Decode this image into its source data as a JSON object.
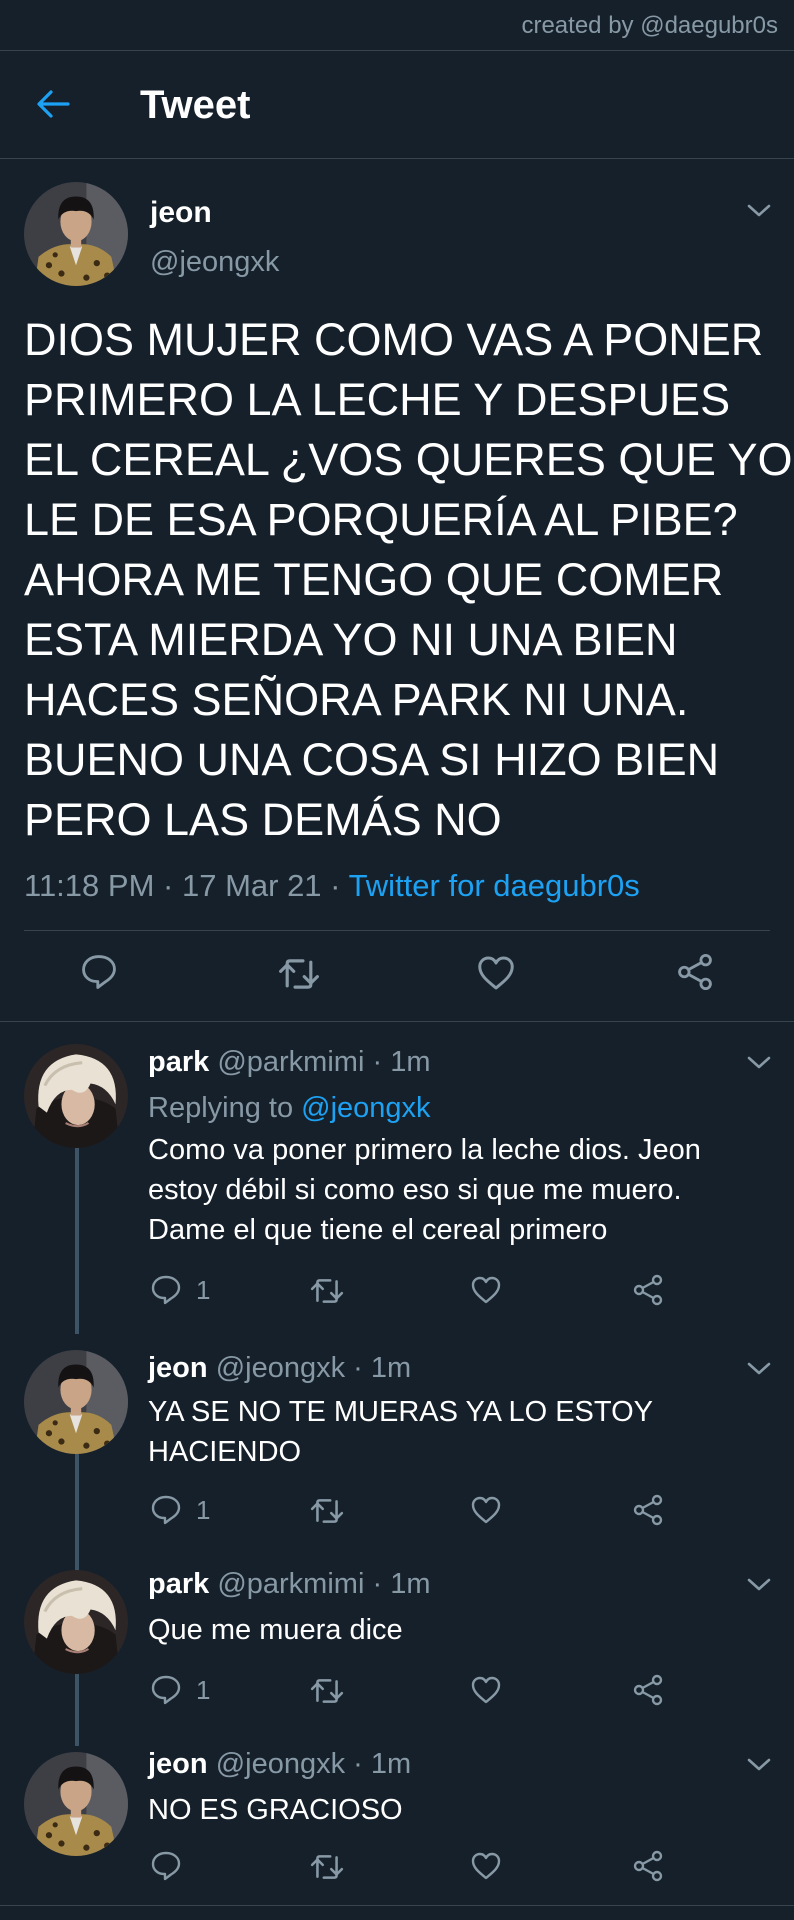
{
  "watermark": "created by @daegubr0s",
  "header": {
    "title": "Tweet",
    "back_icon": "arrow-left-icon"
  },
  "main_tweet": {
    "name": "jeon",
    "handle": "@jeongxk",
    "text_lines": [
      "DIOS MUJER COMO VAS A PONER",
      "PRIMERO LA LECHE Y DESPUES",
      "EL CEREAL ¿VOS QUERES QUE YO",
      "LE DE ESA PORQUERÍA AL PIBE?",
      "AHORA ME TENGO QUE COMER",
      "ESTA MIERDA YO NI UNA BIEN",
      "HACES SEÑORA PARK NI UNA.",
      "BUENO UNA COSA SI HIZO BIEN",
      "PERO LAS DEMÁS NO"
    ],
    "time": "11:18 PM",
    "date": "17 Mar 21",
    "separator": "·",
    "source": "Twitter for daegubr0s"
  },
  "replies": [
    {
      "name": "park",
      "handle": "@parkmimi",
      "time": "1m",
      "replying_prefix": "Replying to",
      "replying_to": "@jeongxk",
      "text_lines": [
        "Como va poner primero la leche dios. Jeon",
        "estoy débil si como eso si que me muero.",
        "Dame el que tiene el cereal primero"
      ],
      "reply_count": "1"
    },
    {
      "name": "jeon",
      "handle": "@jeongxk",
      "time": "1m",
      "text_lines": [
        "YA SE NO TE MUERAS YA LO ESTOY",
        "HACIENDO"
      ],
      "reply_count": "1"
    },
    {
      "name": "park",
      "handle": "@parkmimi",
      "time": "1m",
      "text_lines": [
        "Que me muera dice"
      ],
      "reply_count": "1"
    },
    {
      "name": "jeon",
      "handle": "@jeongxk",
      "time": "1m",
      "text_lines": [
        "NO ES GRACIOSO"
      ],
      "reply_count": ""
    }
  ],
  "colors": {
    "background": "#15202b",
    "divider": "#38444d",
    "secondary_text": "#8899a6",
    "accent": "#1da1f2",
    "thread_line": "#3d5466"
  },
  "icons": {
    "reply": "speech-bubble-icon",
    "retweet": "retweet-icon",
    "like": "heart-icon",
    "share": "share-icon",
    "more": "chevron-down-icon"
  }
}
